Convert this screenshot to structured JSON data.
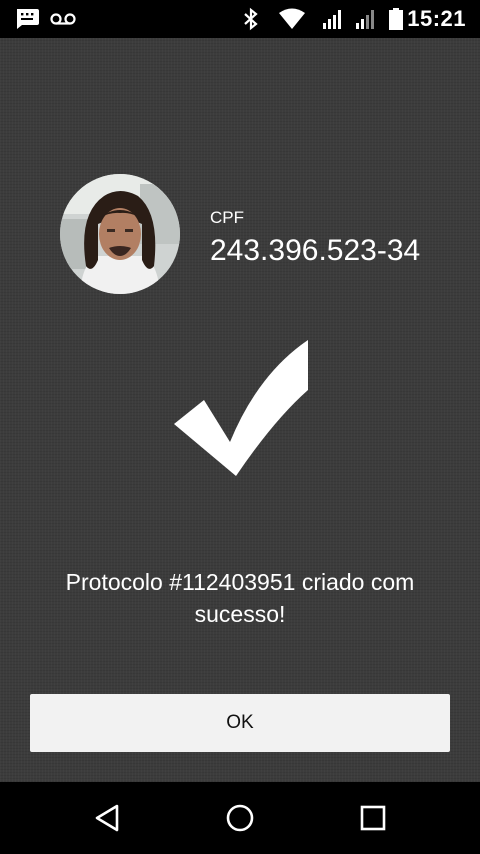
{
  "status_bar": {
    "time": "15:21",
    "icons": [
      "message-icon",
      "voicemail-icon",
      "bluetooth-icon",
      "wifi-icon",
      "signal-icon",
      "signal-icon",
      "battery-icon"
    ]
  },
  "profile": {
    "cpf_label": "CPF",
    "cpf_value": "243.396.523-34"
  },
  "confirmation": {
    "icon": "checkmark-icon",
    "message": "Protocolo #112403951 criado com sucesso!"
  },
  "actions": {
    "ok_label": "OK"
  },
  "nav_bar": {
    "icons": [
      "back-icon",
      "home-icon",
      "recents-icon"
    ]
  },
  "colors": {
    "background": "#3c3c3c",
    "button_bg": "#f2f2f2",
    "text": "#ffffff"
  }
}
